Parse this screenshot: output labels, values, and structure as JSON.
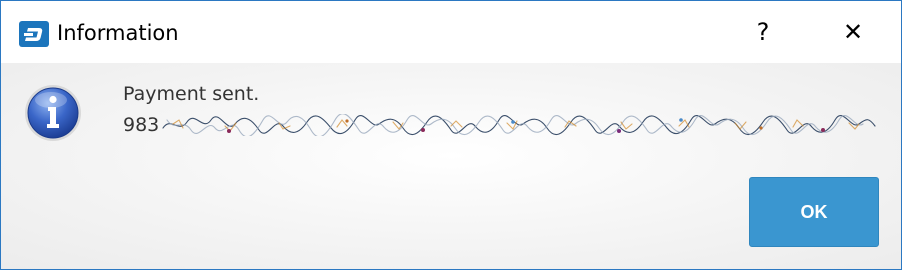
{
  "window": {
    "title": "Information",
    "help_glyph": "?",
    "close_glyph": "✕",
    "app_icon": "dash-logo-icon"
  },
  "message": {
    "icon": "info-icon",
    "line1": "Payment sent.",
    "tx_prefix": "983"
  },
  "buttons": {
    "ok_label": "OK"
  },
  "colors": {
    "window_border": "#2b78c2",
    "app_icon_bg": "#1c75bc",
    "ok_button_bg": "#3a96d0",
    "info_icon_blue": "#2a56b8"
  }
}
